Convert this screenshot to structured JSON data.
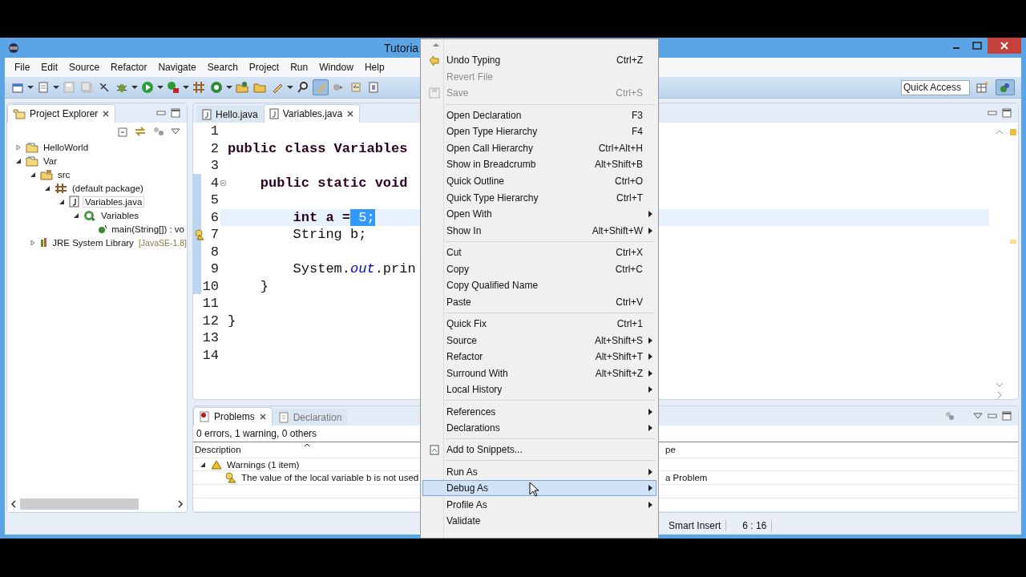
{
  "window": {
    "title": "Tutoria"
  },
  "menu_bar": [
    "File",
    "Edit",
    "Source",
    "Refactor",
    "Navigate",
    "Search",
    "Project",
    "Run",
    "Window",
    "Help"
  ],
  "quick_access": {
    "placeholder": "Quick Access"
  },
  "project_explorer": {
    "title": "Project Explorer",
    "tree": [
      {
        "label": "HelloWorld",
        "kind": "project",
        "expanded": false,
        "selected": false
      },
      {
        "label": "Var",
        "kind": "project",
        "expanded": true,
        "selected": false,
        "children": [
          {
            "label": "src",
            "kind": "source-folder",
            "expanded": true,
            "selected": false,
            "children": [
              {
                "label": "(default package)",
                "kind": "package",
                "expanded": true,
                "selected": false,
                "children": [
                  {
                    "label": "Variables.java",
                    "kind": "java-file",
                    "expanded": true,
                    "selected": true,
                    "children": [
                      {
                        "label": "Variables",
                        "kind": "class",
                        "expanded": true,
                        "selected": false,
                        "children": [
                          {
                            "label": "main(String[]) : vo",
                            "kind": "method",
                            "selected": false
                          }
                        ]
                      }
                    ]
                  }
                ]
              }
            ]
          },
          {
            "label": "JRE System Library",
            "note": "[JavaSE-1.8]",
            "kind": "library",
            "expanded": false,
            "selected": false
          }
        ]
      }
    ]
  },
  "editor": {
    "tabs": [
      {
        "label": "Hello.java",
        "selected": false
      },
      {
        "label": "Variables.java",
        "selected": true
      }
    ],
    "lines": [
      {
        "number": "1"
      },
      {
        "number": "2",
        "segments": [
          {
            "text": "public class Variables",
            "kind": "keyword"
          }
        ]
      },
      {
        "number": "3"
      },
      {
        "number": "4",
        "folded": false,
        "segments": [
          {
            "text": "    public static void",
            "kind": "keyword"
          }
        ]
      },
      {
        "number": "5"
      },
      {
        "number": "6",
        "current": true,
        "segments": [
          {
            "text": "        int a =",
            "kind": "keyword"
          },
          {
            "text": " 5;",
            "kind": "selected"
          }
        ]
      },
      {
        "number": "7",
        "warning": true,
        "segments": [
          {
            "text": "        String b;",
            "kind": "plain"
          }
        ]
      },
      {
        "number": "8"
      },
      {
        "number": "9",
        "segments": [
          {
            "text": "        System.",
            "kind": "plain"
          },
          {
            "text": "out",
            "kind": "field"
          },
          {
            "text": ".prin",
            "kind": "plain"
          }
        ]
      },
      {
        "number": "10",
        "segments": [
          {
            "text": "    }",
            "kind": "plain"
          }
        ]
      },
      {
        "number": "11"
      },
      {
        "number": "12",
        "segments": [
          {
            "text": "}",
            "kind": "plain"
          }
        ]
      },
      {
        "number": "13"
      },
      {
        "number": "14"
      }
    ]
  },
  "problems": {
    "tabs": [
      {
        "label": "Problems",
        "selected": true
      },
      {
        "label": "Declaration",
        "selected": false
      }
    ],
    "summary": "0 errors, 1 warning, 0 others",
    "columns": {
      "description": "Description",
      "column_2": "pe"
    },
    "rows": [
      {
        "description": "Warnings (1 item)",
        "expanded": true,
        "children": [
          {
            "description": "The value of the local variable b is not used",
            "column_2": "a Problem"
          }
        ]
      }
    ]
  },
  "status_bar": [
    "Smart Insert",
    "6 : 16"
  ],
  "context_menu": [
    {
      "kind": "icon-item",
      "label": "Undo Typing",
      "shortcut": "Ctrl+Z",
      "disabled": false,
      "submenu": false,
      "selected": false
    },
    {
      "kind": "item",
      "label": "Revert File",
      "disabled": true,
      "submenu": false,
      "selected": false
    },
    {
      "kind": "icon-item",
      "label": "Save",
      "shortcut": "Ctrl+S",
      "disabled": true,
      "submenu": false,
      "selected": false
    },
    {
      "kind": "separator"
    },
    {
      "kind": "item",
      "label": "Open Declaration",
      "shortcut": "F3",
      "disabled": false,
      "submenu": false,
      "selected": false
    },
    {
      "kind": "item",
      "label": "Open Type Hierarchy",
      "shortcut": "F4",
      "disabled": false,
      "submenu": false,
      "selected": false
    },
    {
      "kind": "item",
      "label": "Open Call Hierarchy",
      "shortcut": "Ctrl+Alt+H",
      "disabled": false,
      "submenu": false,
      "selected": false
    },
    {
      "kind": "item",
      "label": "Show in Breadcrumb",
      "shortcut": "Alt+Shift+B",
      "disabled": false,
      "submenu": false,
      "selected": false
    },
    {
      "kind": "item",
      "label": "Quick Outline",
      "shortcut": "Ctrl+O",
      "disabled": false,
      "submenu": false,
      "selected": false
    },
    {
      "kind": "item",
      "label": "Quick Type Hierarchy",
      "shortcut": "Ctrl+T",
      "disabled": false,
      "submenu": false,
      "selected": false
    },
    {
      "kind": "item",
      "label": "Open With",
      "disabled": false,
      "submenu": true,
      "selected": false
    },
    {
      "kind": "item",
      "label": "Show In",
      "shortcut": "Alt+Shift+W",
      "disabled": false,
      "submenu": true,
      "selected": false
    },
    {
      "kind": "separator"
    },
    {
      "kind": "item",
      "label": "Cut",
      "shortcut": "Ctrl+X",
      "disabled": false,
      "submenu": false,
      "selected": false
    },
    {
      "kind": "item",
      "label": "Copy",
      "shortcut": "Ctrl+C",
      "disabled": false,
      "submenu": false,
      "selected": false
    },
    {
      "kind": "item",
      "label": "Copy Qualified Name",
      "disabled": false,
      "submenu": false,
      "selected": false
    },
    {
      "kind": "item",
      "label": "Paste",
      "shortcut": "Ctrl+V",
      "disabled": false,
      "submenu": false,
      "selected": false
    },
    {
      "kind": "separator"
    },
    {
      "kind": "item",
      "label": "Quick Fix",
      "shortcut": "Ctrl+1",
      "disabled": false,
      "submenu": false,
      "selected": false
    },
    {
      "kind": "item",
      "label": "Source",
      "shortcut": "Alt+Shift+S",
      "disabled": false,
      "submenu": true,
      "selected": false
    },
    {
      "kind": "item",
      "label": "Refactor",
      "shortcut": "Alt+Shift+T",
      "disabled": false,
      "submenu": true,
      "selected": false
    },
    {
      "kind": "item",
      "label": "Surround With",
      "shortcut": "Alt+Shift+Z",
      "disabled": false,
      "submenu": true,
      "selected": false
    },
    {
      "kind": "item",
      "label": "Local History",
      "disabled": false,
      "submenu": true,
      "selected": false
    },
    {
      "kind": "separator"
    },
    {
      "kind": "item",
      "label": "References",
      "disabled": false,
      "submenu": true,
      "selected": false
    },
    {
      "kind": "item",
      "label": "Declarations",
      "disabled": false,
      "submenu": true,
      "selected": false
    },
    {
      "kind": "separator"
    },
    {
      "kind": "icon-item",
      "label": "Add to Snippets...",
      "disabled": false,
      "submenu": false,
      "selected": false
    },
    {
      "kind": "separator"
    },
    {
      "kind": "item",
      "label": "Run As",
      "disabled": false,
      "submenu": true,
      "selected": false
    },
    {
      "kind": "item",
      "label": "Debug As",
      "disabled": false,
      "submenu": true,
      "selected": true
    },
    {
      "kind": "item",
      "label": "Profile As",
      "disabled": false,
      "submenu": true,
      "selected": false
    },
    {
      "kind": "item",
      "label": "Validate",
      "disabled": false,
      "submenu": false,
      "selected": false
    }
  ]
}
